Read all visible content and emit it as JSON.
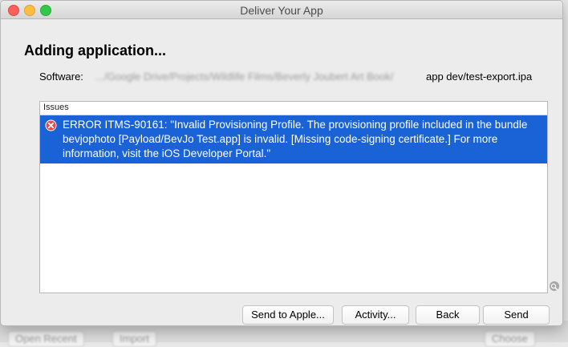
{
  "window": {
    "title": "Deliver Your App"
  },
  "sheet": {
    "heading": "Adding application...",
    "software_label": "Software:",
    "software_path_blurred": ".../Google Drive/Projects/Wildlife Films/Beverly Joubert Art Book/",
    "software_path_visible": "app dev/test-export.ipa"
  },
  "issues": {
    "header": "Issues",
    "items": [
      {
        "icon": "error-icon",
        "text": "ERROR ITMS-90161: \"Invalid Provisioning Profile. The provisioning profile included in the bundle bevjophoto [Payload/BevJo Test.app] is invalid. [Missing code-signing certificate.] For more information, visit the iOS Developer Portal.\""
      }
    ]
  },
  "buttons": {
    "send_to_apple": "Send to Apple...",
    "activity": "Activity...",
    "back": "Back",
    "send": "Send"
  },
  "background_window": {
    "left_button": "Open Recent",
    "middle_button": "Import",
    "right_button": "Choose"
  },
  "colors": {
    "selection": "#1a63d6",
    "close_light": "#fc605c",
    "minimize_light": "#fdbc40",
    "zoom_light": "#34c84a",
    "error_icon": "#e84a4a"
  }
}
